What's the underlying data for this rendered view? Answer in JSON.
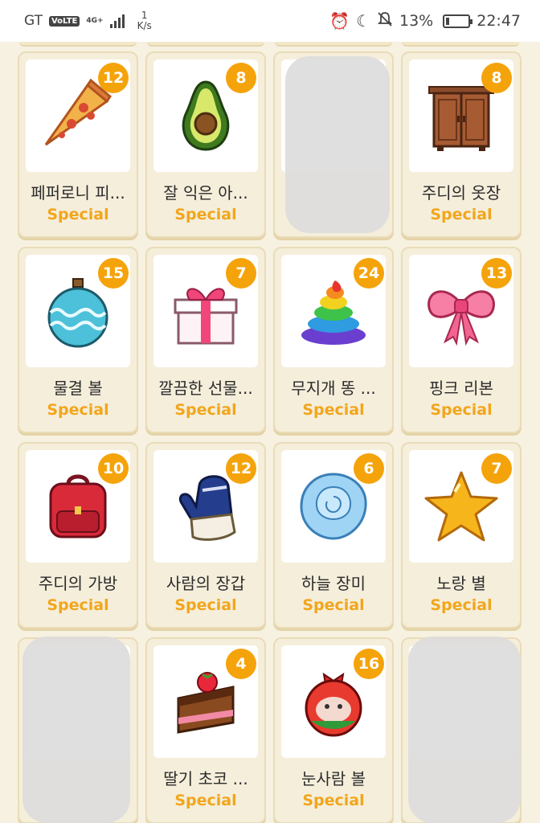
{
  "status_bar": {
    "carrier": "GT",
    "volte": "VoLTE",
    "network": "4G+",
    "speed_value": "1",
    "speed_unit": "K/s",
    "battery": "13%",
    "time": "22:47"
  },
  "items": [
    {
      "name": "페퍼로니 피...",
      "tag": "Special",
      "count": "12",
      "icon": "pizza-slice-icon"
    },
    {
      "name": "잘 익은 아...",
      "tag": "Special",
      "count": "8",
      "icon": "avocado-icon"
    },
    {
      "name": "",
      "tag": "",
      "count": "",
      "icon": "redacted"
    },
    {
      "name": "주디의 옷장",
      "tag": "Special",
      "count": "8",
      "icon": "wardrobe-icon"
    },
    {
      "name": "물결 볼",
      "tag": "Special",
      "count": "15",
      "icon": "wave-ornament-ball-icon"
    },
    {
      "name": "깔끔한 선물...",
      "tag": "Special",
      "count": "7",
      "icon": "gift-box-icon"
    },
    {
      "name": "무지개 똥 ...",
      "tag": "Special",
      "count": "24",
      "icon": "rainbow-poop-icon"
    },
    {
      "name": "핑크 리본",
      "tag": "Special",
      "count": "13",
      "icon": "pink-ribbon-icon"
    },
    {
      "name": "주디의 가방",
      "tag": "Special",
      "count": "10",
      "icon": "red-backpack-icon"
    },
    {
      "name": "사람의 장갑",
      "tag": "Special",
      "count": "12",
      "icon": "mitten-icon"
    },
    {
      "name": "하늘 장미",
      "tag": "Special",
      "count": "6",
      "icon": "blue-rose-icon"
    },
    {
      "name": "노랑 별",
      "tag": "Special",
      "count": "7",
      "icon": "yellow-star-icon"
    },
    {
      "name": "",
      "tag": "",
      "count": "",
      "icon": "redacted"
    },
    {
      "name": "딸기 초코 ...",
      "tag": "Special",
      "count": "4",
      "icon": "strawberry-cake-icon"
    },
    {
      "name": "눈사람 볼",
      "tag": "Special",
      "count": "16",
      "icon": "snowman-ornament-icon"
    },
    {
      "name": "",
      "tag": "",
      "count": "",
      "icon": "redacted"
    }
  ]
}
